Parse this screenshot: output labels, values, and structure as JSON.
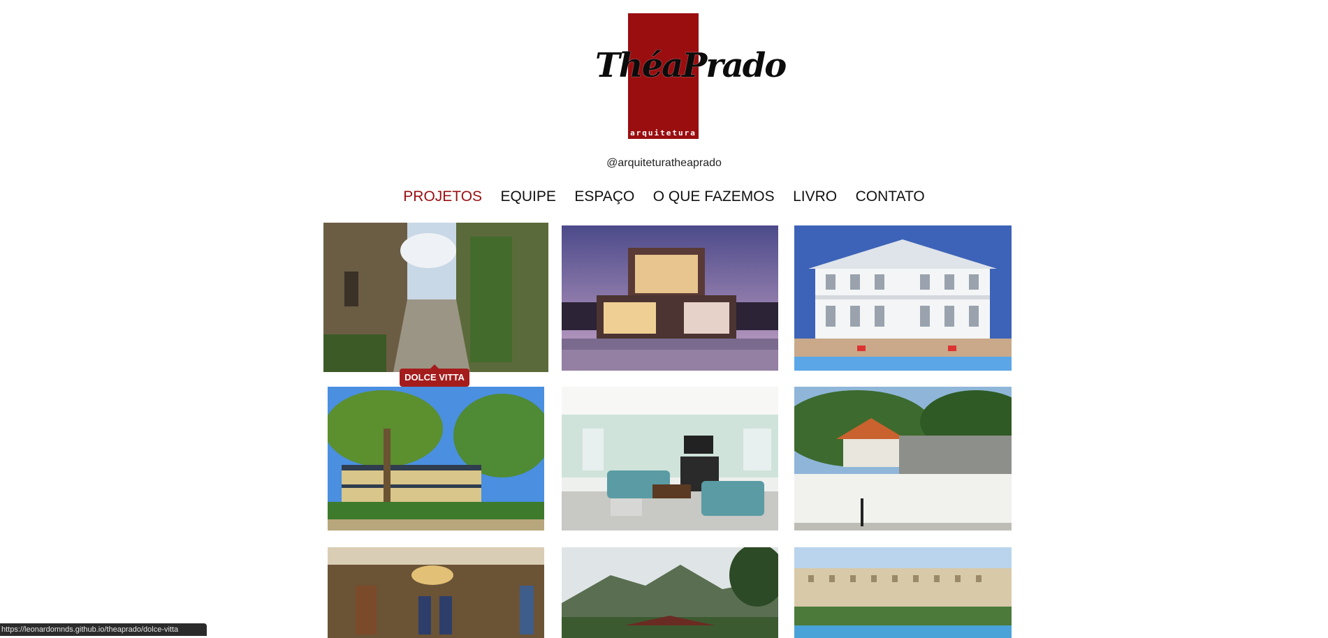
{
  "logo": {
    "brand": "ThéaPrado",
    "sub": "arquitetura",
    "accent": "#9a0e10"
  },
  "handle": "@arquiteturatheaprado",
  "nav": {
    "items": [
      "PROJETOS",
      "EQUIPE",
      "ESPAÇO",
      "O QUE FAZEMOS",
      "LIVRO",
      "CONTATO"
    ],
    "active": "PROJETOS",
    "active_color": "#9a0e10"
  },
  "projects": {
    "tiles": [
      {
        "alt": "stone-alley-photo"
      },
      {
        "alt": "modern-house-photo"
      },
      {
        "alt": "white-mansion-photo"
      },
      {
        "alt": "tropical-house-photo"
      },
      {
        "alt": "living-room-photo"
      },
      {
        "alt": "temple-photo"
      },
      {
        "alt": "ballroom-photo"
      },
      {
        "alt": "mountain-pagoda-photo"
      },
      {
        "alt": "resort-photo"
      }
    ],
    "tooltip": "DOLCE VITTA"
  },
  "status_url": "https://leonardomnds.github.io/theaprado/dolce-vitta"
}
